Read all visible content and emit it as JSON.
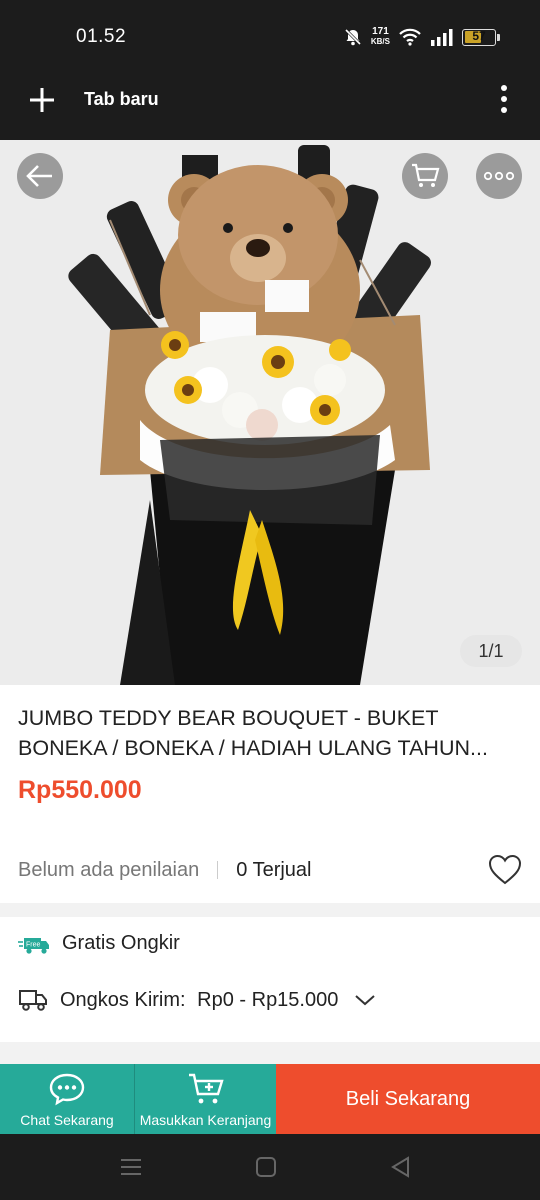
{
  "status_bar": {
    "time": "01.52",
    "net_speed_value": "171",
    "net_speed_unit": "KB/S",
    "battery_level": "57",
    "icons": [
      "bell-muted-icon",
      "wifi-icon",
      "signal-icon",
      "battery-icon"
    ]
  },
  "browser": {
    "tab_title": "Tab baru",
    "icons": [
      "plus-icon",
      "overflow-menu-icon"
    ]
  },
  "image": {
    "counter": "1/1",
    "icons": [
      "back-arrow-icon",
      "cart-icon",
      "more-icon"
    ]
  },
  "product": {
    "title": "JUMBO TEDDY BEAR BOUQUET - BUKET BONEKA / BONEKA / HADIAH ULANG TAHUN...",
    "price": "Rp550.000",
    "rating_text": "Belum ada penilaian",
    "sold_text": "0 Terjual"
  },
  "shipping": {
    "free_label": "Gratis Ongkir",
    "free_badge": "Free",
    "cost_label": "Ongkos Kirim:",
    "cost_value": "Rp0 - Rp15.000"
  },
  "actions": {
    "chat_label": "Chat Sekarang",
    "cart_label": "Masukkan Keranjang",
    "buy_label": "Beli Sekarang"
  },
  "colors": {
    "accent_orange": "#ee4d2d",
    "accent_teal": "#26aa99",
    "dark_bar": "#1c1c1c"
  }
}
